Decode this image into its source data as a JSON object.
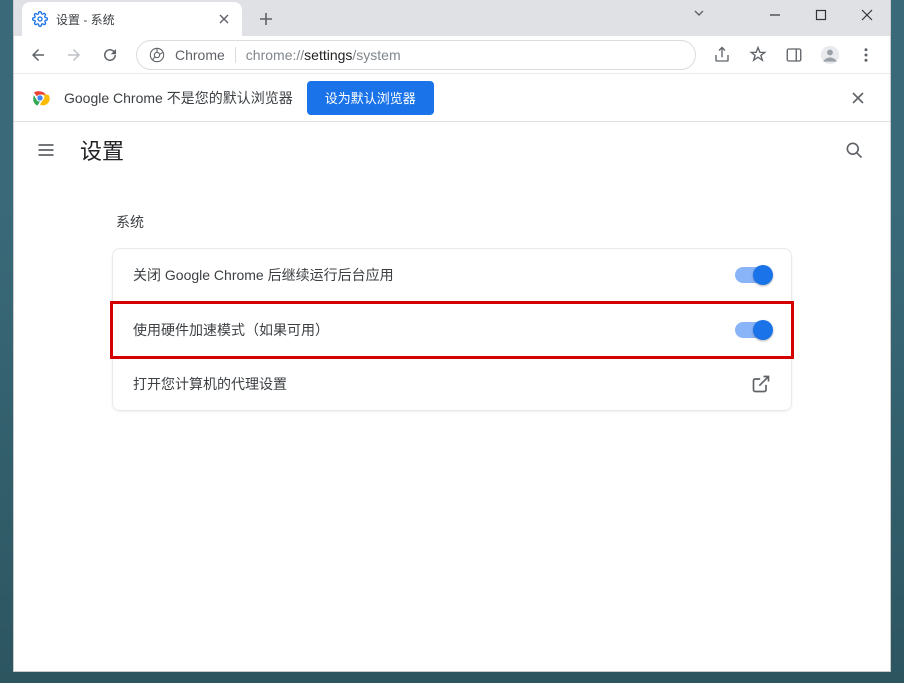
{
  "tab": {
    "title": "设置 - 系统"
  },
  "omnibox": {
    "site_label": "Chrome",
    "url_prefix": "chrome://",
    "url_bold": "settings",
    "url_suffix": "/system"
  },
  "infobar": {
    "message": "Google Chrome 不是您的默认浏览器",
    "button_label": "设为默认浏览器"
  },
  "settings": {
    "page_title": "设置",
    "section_title": "系统",
    "rows": {
      "background_apps": "关闭 Google Chrome 后继续运行后台应用",
      "hardware_accel": "使用硬件加速模式（如果可用）",
      "proxy": "打开您计算机的代理设置"
    }
  }
}
